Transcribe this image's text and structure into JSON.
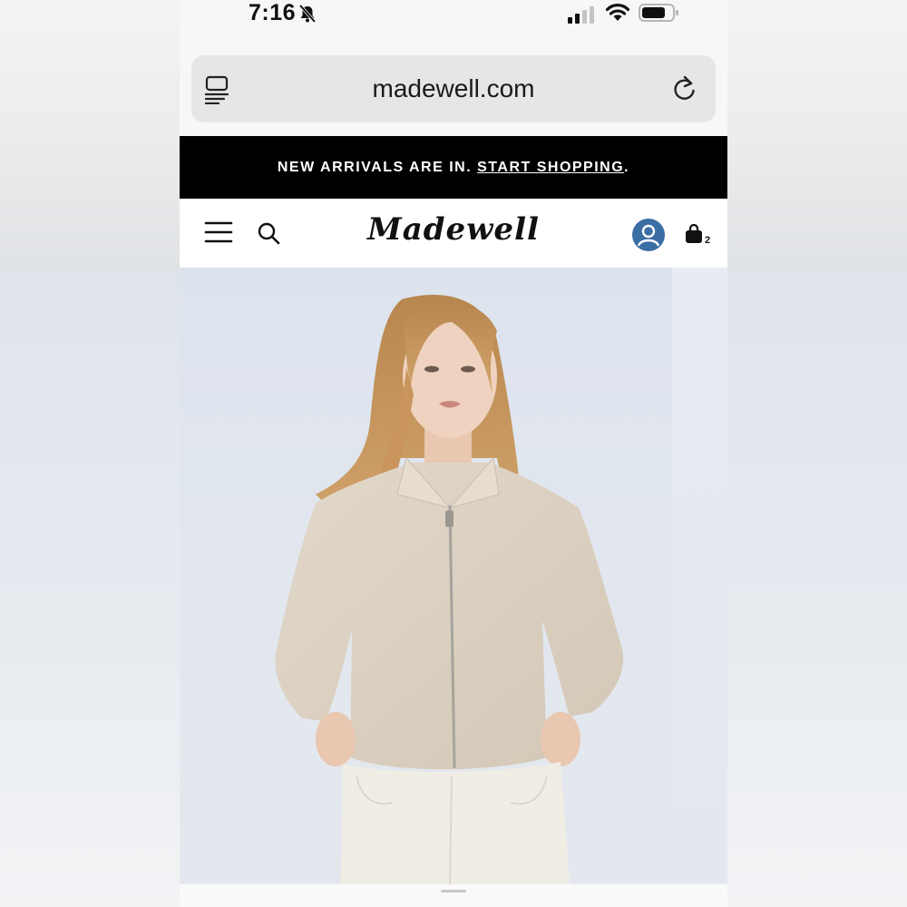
{
  "status_bar": {
    "time": "7:16",
    "icons": [
      "bell-slash-icon",
      "signal-icon",
      "wifi-icon",
      "battery-icon"
    ]
  },
  "browser": {
    "url": "madewell.com",
    "icons": [
      "tabs-icon",
      "reload-icon"
    ]
  },
  "promo": {
    "text": "NEW ARRIVALS ARE IN. ",
    "link": "START SHOPPING",
    "trailing": "."
  },
  "header": {
    "logo": "Madewell",
    "cart_count": "2",
    "icons": [
      "menu-icon",
      "search-icon",
      "account-icon",
      "bag-icon"
    ],
    "account_color": "#3a6ea5"
  },
  "hero": {
    "image": "model-in-beige-zip-cardigan"
  },
  "colors": {
    "banner_bg": "#000000",
    "banner_text": "#ffffff",
    "sweater": "#dcd1c3"
  }
}
